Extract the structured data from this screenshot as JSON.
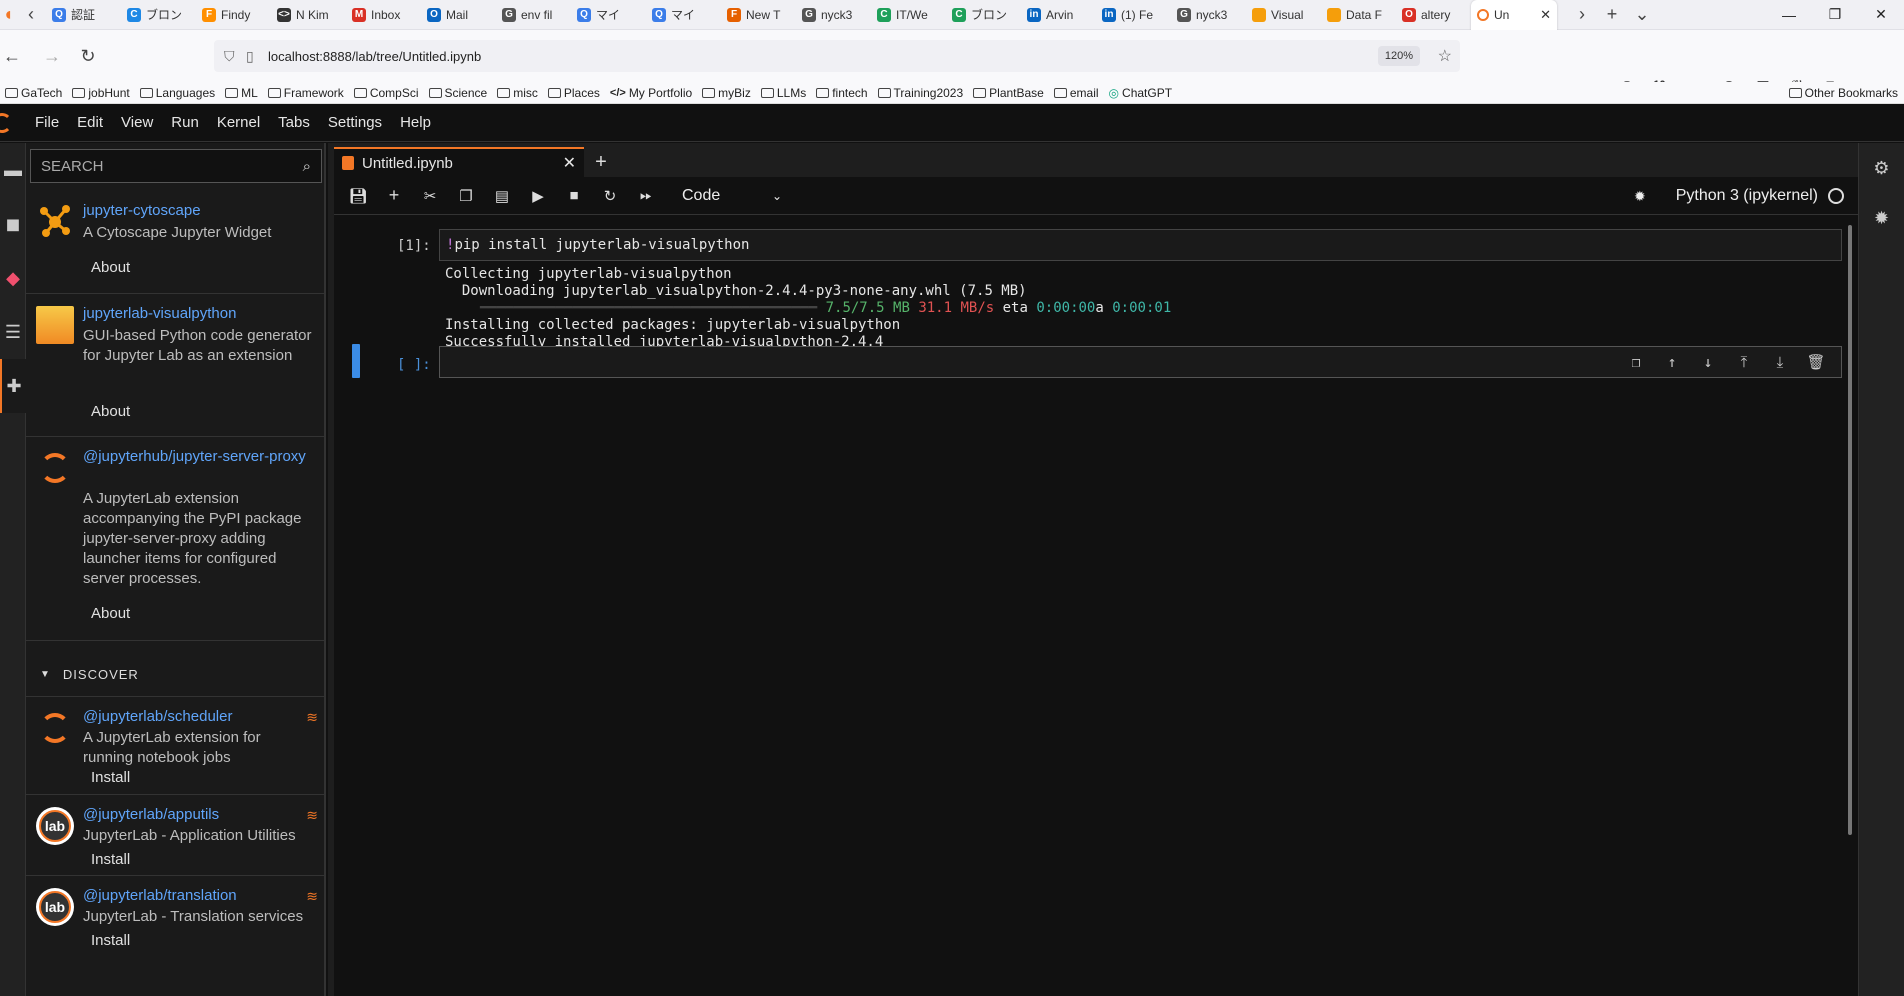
{
  "browser": {
    "tabs": [
      {
        "label": "認証",
        "color": "#3b7de9",
        "glyph": "Q"
      },
      {
        "label": "ブロン",
        "color": "#1e88e5",
        "glyph": "C"
      },
      {
        "label": "Findy",
        "color": "#ff8f00",
        "glyph": "F"
      },
      {
        "label": "N Kim",
        "color": "#333333",
        "glyph": "<>"
      },
      {
        "label": "Inbox",
        "color": "#d93025",
        "glyph": "M"
      },
      {
        "label": "Mail",
        "color": "#0a66c2",
        "glyph": "O"
      },
      {
        "label": "env fil",
        "color": "#555555",
        "glyph": "G"
      },
      {
        "label": "マイ",
        "color": "#3b7de9",
        "glyph": "Q"
      },
      {
        "label": "マイ",
        "color": "#3b7de9",
        "glyph": "Q"
      },
      {
        "label": "New T",
        "color": "#e66000",
        "glyph": "F"
      },
      {
        "label": "nyck3",
        "color": "#555555",
        "glyph": "G"
      },
      {
        "label": "IT/We",
        "color": "#1ea05a",
        "glyph": "C"
      },
      {
        "label": "ブロン",
        "color": "#1ea05a",
        "glyph": "C"
      },
      {
        "label": "Arvin",
        "color": "#0a66c2",
        "glyph": "in"
      },
      {
        "label": "(1) Fe",
        "color": "#0a66c2",
        "glyph": "in"
      },
      {
        "label": "nyck3",
        "color": "#555555",
        "glyph": "G"
      },
      {
        "label": "Visual",
        "color": "#f59e0b",
        "glyph": ""
      },
      {
        "label": "Data F",
        "color": "#f59e0b",
        "glyph": ""
      },
      {
        "label": "altery",
        "color": "#d93025",
        "glyph": "O"
      }
    ],
    "active_tab": {
      "label": "Un",
      "color": "#f37726"
    },
    "url": "localhost:8888/lab/tree/Untitled.ipynb",
    "zoom": "120%",
    "bookmarks": [
      "GaTech",
      "jobHunt",
      "Languages",
      "ML",
      "Framework",
      "CompSci",
      "Science",
      "misc",
      "Places",
      "My Portfolio",
      "myBiz",
      "LLMs",
      "fintech",
      "Training2023",
      "PlantBase",
      "email",
      "ChatGPT"
    ],
    "other_bookmarks": "Other Bookmarks"
  },
  "menu": [
    "File",
    "Edit",
    "View",
    "Run",
    "Kernel",
    "Tabs",
    "Settings",
    "Help"
  ],
  "sidebar": {
    "search_placeholder": "SEARCH",
    "installed": [
      {
        "name": "jupyter-cytoscape",
        "desc": "A Cytoscape Jupyter Widget",
        "button": "About",
        "icon": "cytoscape-icon"
      },
      {
        "name": "jupyterlab-visualpython",
        "desc": "GUI-based Python code generator for Jupyter Lab as an extension",
        "button": "About",
        "icon": "visualpython-icon"
      },
      {
        "name": "@jupyterhub/jupyter-server-proxy",
        "desc": "A JupyterLab extension accompanying the PyPI package jupyter-server-proxy adding launcher items for configured server processes.",
        "button": "About",
        "icon": "jupyter-icon"
      }
    ],
    "discover_label": "DISCOVER",
    "discover": [
      {
        "name": "@jupyterlab/scheduler",
        "desc": "A JupyterLab extension for running notebook jobs",
        "button": "Install"
      },
      {
        "name": "@jupyterlab/apputils",
        "desc": "JupyterLab - Application Utilities",
        "button": "Install"
      },
      {
        "name": "@jupyterlab/translation",
        "desc": "JupyterLab - Translation services",
        "button": "Install"
      }
    ]
  },
  "notebook": {
    "tab_title": "Untitled.ipynb",
    "cell_type": "Code",
    "kernel": "Python 3 (ipykernel)",
    "cell1": {
      "prompt": "[1]:",
      "bang": "!",
      "code": "pip install jupyterlab-visualpython",
      "out1": "Collecting jupyterlab-visualpython",
      "out2": "  Downloading jupyterlab_visualpython-2.4.4-py3-none-any.whl (7.5 MB)",
      "progress_bar": "━━━━━━━━━━━━━━━━━━━━━━━━━━━━━━━━━━━━━━━━",
      "progress_size": "7.5/7.5 MB",
      "progress_speed": "31.1 MB/s",
      "progress_eta_label": "eta",
      "progress_eta": "0:00:00",
      "progress_a": "a",
      "progress_elapsed": "0:00:01",
      "out4": "Installing collected packages: jupyterlab-visualpython",
      "out5": "Successfully installed jupyterlab-visualpython-2.4.4"
    },
    "cell2": {
      "prompt": "[ ]:"
    }
  }
}
